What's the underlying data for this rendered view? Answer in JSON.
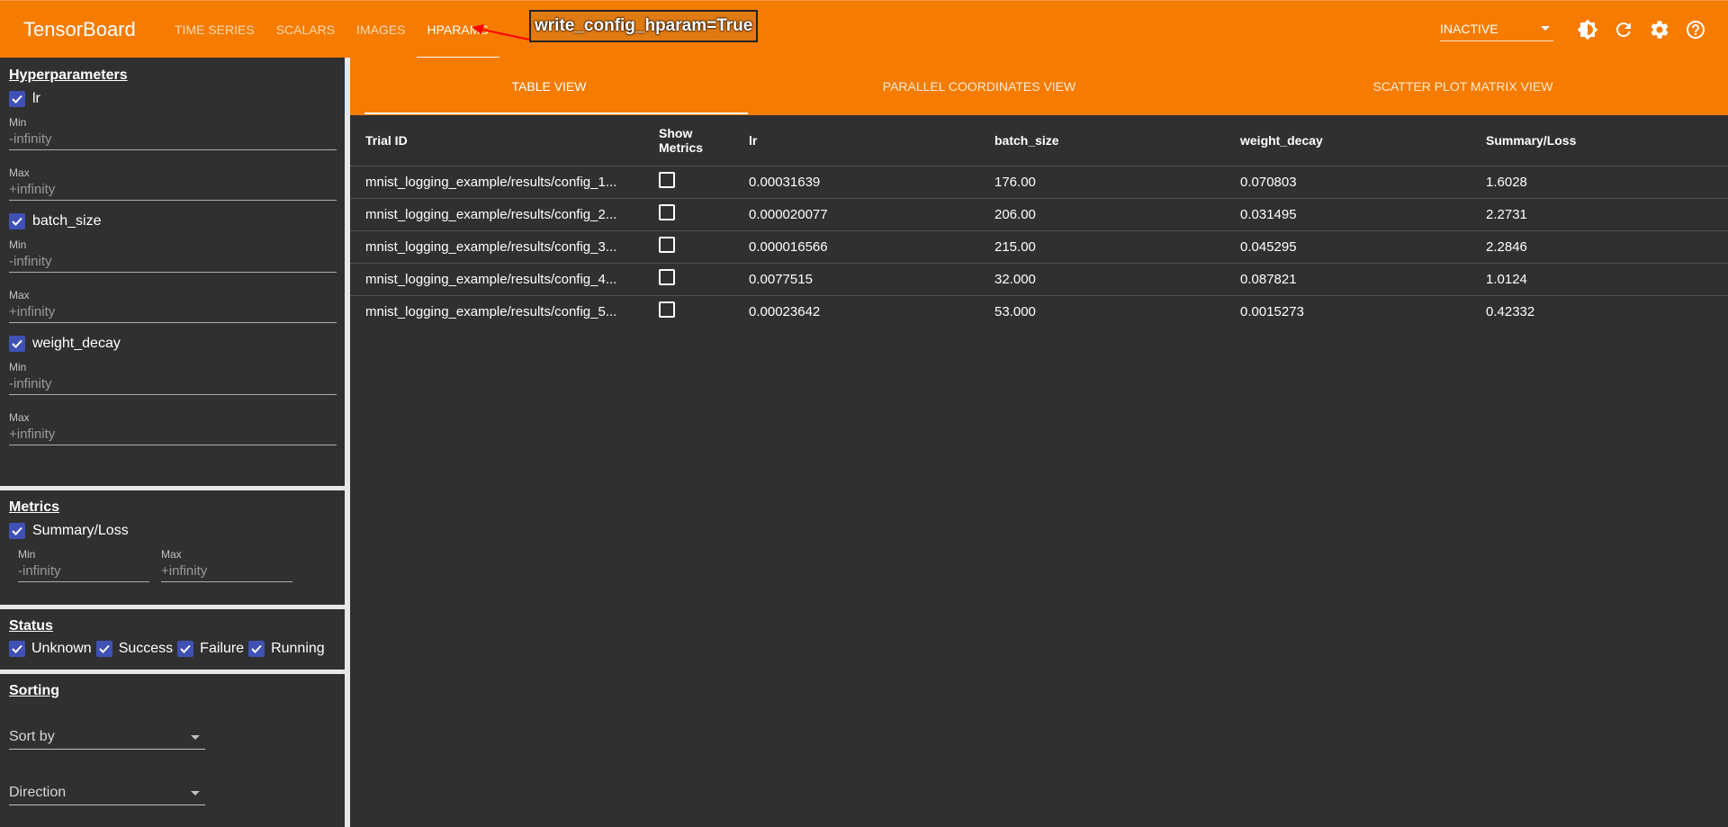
{
  "app": {
    "title": "TensorBoard"
  },
  "nav": {
    "tabs": [
      "TIME SERIES",
      "SCALARS",
      "IMAGES",
      "HPARAMS"
    ],
    "active": "HPARAMS"
  },
  "annotation": {
    "text": "write_config_hparam=True",
    "color": "#ff0000"
  },
  "topright": {
    "status_select": "INACTIVE",
    "icons": [
      "brightness-icon",
      "refresh-icon",
      "settings-icon",
      "help-icon"
    ]
  },
  "sidebar": {
    "hyperparameters": {
      "title": "Hyperparameters",
      "items": [
        {
          "name": "lr",
          "min_label": "Min",
          "min_placeholder": "-infinity",
          "max_label": "Max",
          "max_placeholder": "+infinity"
        },
        {
          "name": "batch_size",
          "min_label": "Min",
          "min_placeholder": "-infinity",
          "max_label": "Max",
          "max_placeholder": "+infinity"
        },
        {
          "name": "weight_decay",
          "min_label": "Min",
          "min_placeholder": "-infinity",
          "max_label": "Max",
          "max_placeholder": "+infinity"
        }
      ]
    },
    "metrics": {
      "title": "Metrics",
      "item": "Summary/Loss",
      "min_label": "Min",
      "min_placeholder": "-infinity",
      "max_label": "Max",
      "max_placeholder": "+infinity"
    },
    "status": {
      "title": "Status",
      "items": [
        "Unknown",
        "Success",
        "Failure",
        "Running"
      ]
    },
    "sorting": {
      "title": "Sorting",
      "sort_by": "Sort by",
      "direction": "Direction"
    }
  },
  "subtabs": [
    "TABLE VIEW",
    "PARALLEL COORDINATES VIEW",
    "SCATTER PLOT MATRIX VIEW"
  ],
  "table": {
    "headers": {
      "trial": "Trial ID",
      "show1": "Show",
      "show2": "Metrics",
      "lr": "lr",
      "batch": "batch_size",
      "wd": "weight_decay",
      "loss": "Summary/Loss"
    },
    "rows": [
      {
        "trial": "mnist_logging_example/results/config_1...",
        "lr": "0.00031639",
        "batch": "176.00",
        "wd": "0.070803",
        "loss": "1.6028"
      },
      {
        "trial": "mnist_logging_example/results/config_2...",
        "lr": "0.000020077",
        "batch": "206.00",
        "wd": "0.031495",
        "loss": "2.2731"
      },
      {
        "trial": "mnist_logging_example/results/config_3...",
        "lr": "0.000016566",
        "batch": "215.00",
        "wd": "0.045295",
        "loss": "2.2846"
      },
      {
        "trial": "mnist_logging_example/results/config_4...",
        "lr": "0.0077515",
        "batch": "32.000",
        "wd": "0.087821",
        "loss": "1.0124"
      },
      {
        "trial": "mnist_logging_example/results/config_5...",
        "lr": "0.00023642",
        "batch": "53.000",
        "wd": "0.0015273",
        "loss": "0.42332"
      }
    ]
  },
  "colors": {
    "accent": "#f57c00",
    "background": "#303030",
    "checkbox": "#3f51b5"
  }
}
